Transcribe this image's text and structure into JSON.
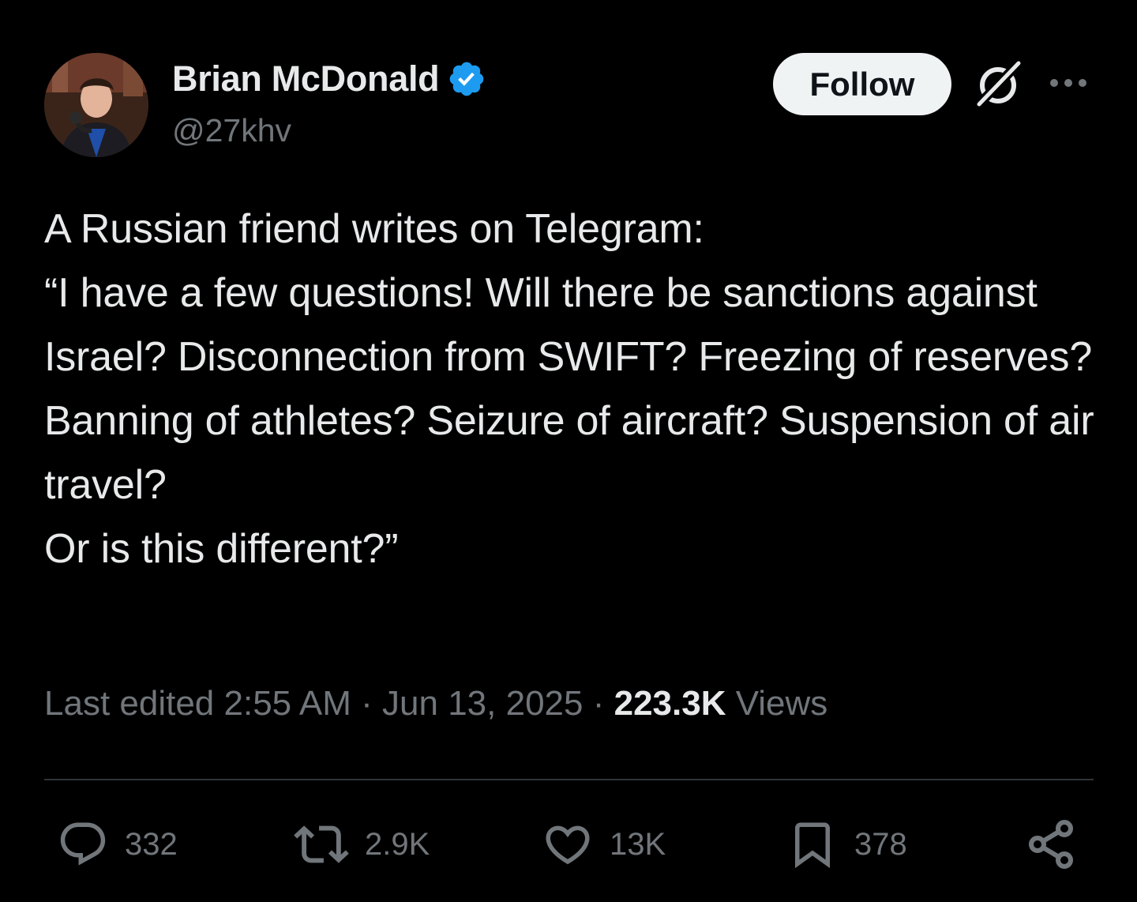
{
  "author": {
    "display_name": "Brian McDonald",
    "handle": "@27khv",
    "verified": true,
    "verified_color": "#1d9bf0"
  },
  "header": {
    "follow_label": "Follow",
    "grok_icon": "grok-icon",
    "more_icon": "more-icon"
  },
  "tweet": {
    "lines": [
      "A Russian friend writes on Telegram:",
      "“I have a few questions! Will there be sanctions against Israel? Disconnection from SWIFT? Freezing of reserves? Banning of athletes? Seizure of aircraft? Suspension of air travel?",
      "",
      "Or is this different?”"
    ]
  },
  "meta": {
    "edited_prefix": "Last edited ",
    "time": "2:55 AM",
    "separator": " · ",
    "date": "Jun 13, 2025",
    "views_count": "223.3K",
    "views_label": " Views"
  },
  "actions": {
    "reply_count": "332",
    "repost_count": "2.9K",
    "like_count": "13K",
    "bookmark_count": "378",
    "reply_icon": "reply-icon",
    "repost_icon": "repost-icon",
    "like_icon": "heart-icon",
    "bookmark_icon": "bookmark-icon",
    "share_icon": "share-icon"
  },
  "colors": {
    "background": "#000000",
    "text": "#e7e9ea",
    "muted": "#71767b",
    "divider": "#2f3336",
    "follow_bg": "#eff3f4"
  }
}
